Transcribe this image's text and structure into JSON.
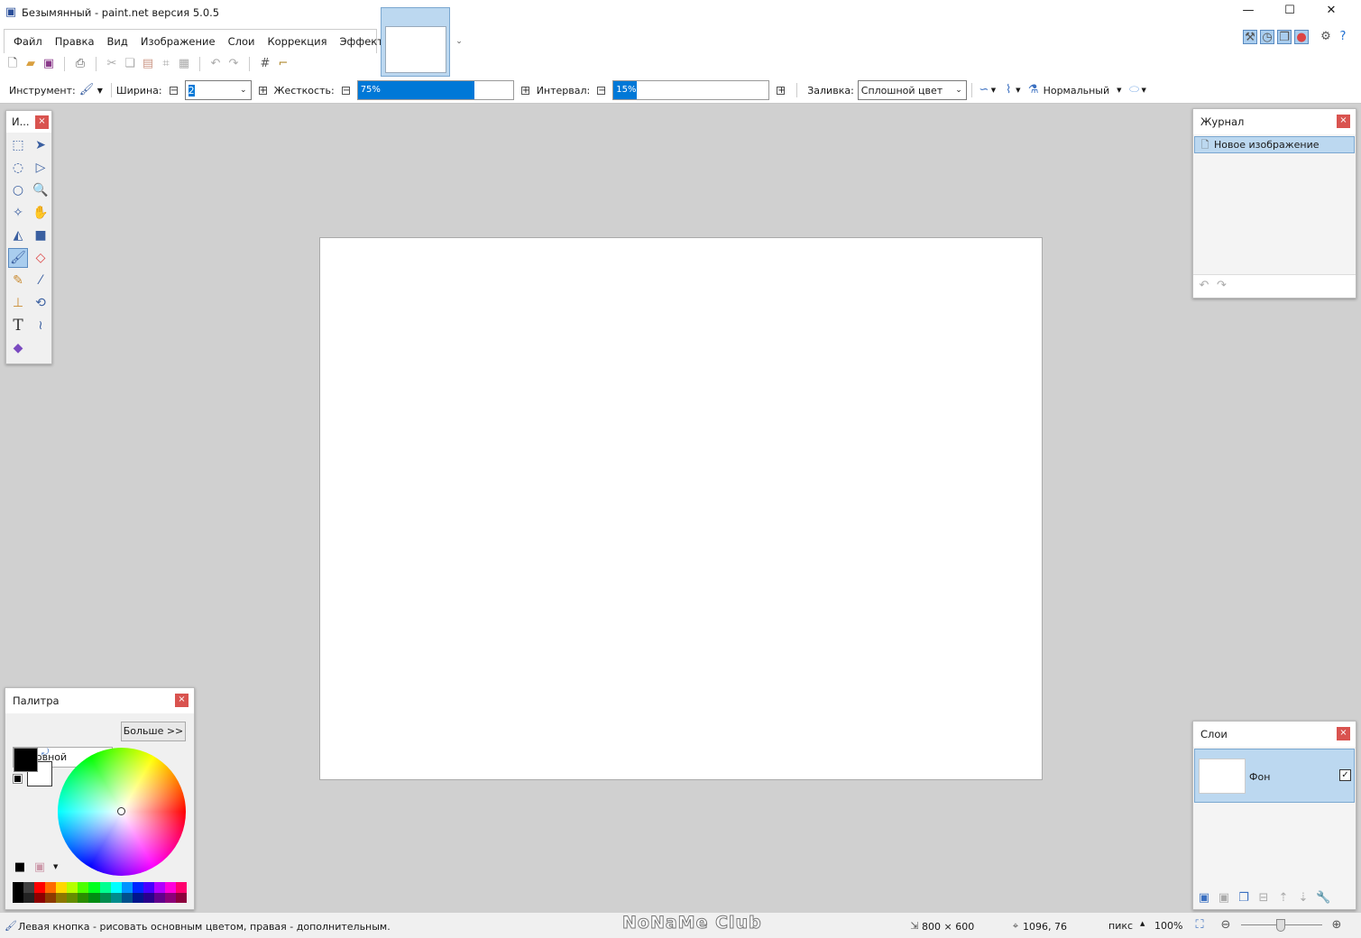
{
  "window": {
    "title": "Безымянный - paint.net версия 5.0.5",
    "minimize": "—",
    "maximize": "☐",
    "close": "✕"
  },
  "menu": [
    "Файл",
    "Правка",
    "Вид",
    "Изображение",
    "Слои",
    "Коррекция",
    "Эффекты"
  ],
  "toolbar_options": {
    "tool_label": "Инструмент:",
    "width_label": "Ширина:",
    "width_value": "2",
    "hardness_label": "Жесткость:",
    "hardness_value": "75%",
    "hardness_percent": 75,
    "interval_label": "Интервал:",
    "interval_value": "15%",
    "interval_percent": 15,
    "fill_label": "Заливка:",
    "fill_value": "Сплошной цвет",
    "blend_mode": "Нормальный"
  },
  "tools_panel": {
    "title": "И..."
  },
  "palette": {
    "title": "Палитра",
    "palette_select": "Основной",
    "more_button": "Больше >>",
    "primary_color": "#000000",
    "secondary_color": "#ffffff"
  },
  "history": {
    "title": "Журнал",
    "items": [
      "Новое изображение"
    ]
  },
  "layers": {
    "title": "Слои",
    "items": [
      {
        "name": "Фон",
        "visible": true
      }
    ]
  },
  "status": {
    "hint": "Левая кнопка - рисовать основным цветом, правая - дополнительным.",
    "image_size": "800 × 600",
    "cursor": "1096, 76",
    "units": "пикс",
    "zoom": "100%",
    "watermark": "NoNaMe Club"
  },
  "palette_colors": [
    "#000000",
    "#404040",
    "#ff0000",
    "#ff6a00",
    "#ffd800",
    "#b6ff00",
    "#4cff00",
    "#00ff21",
    "#00ff90",
    "#00ffff",
    "#0094ff",
    "#0026ff",
    "#4800ff",
    "#b200ff",
    "#ff00dc",
    "#ff006e"
  ]
}
